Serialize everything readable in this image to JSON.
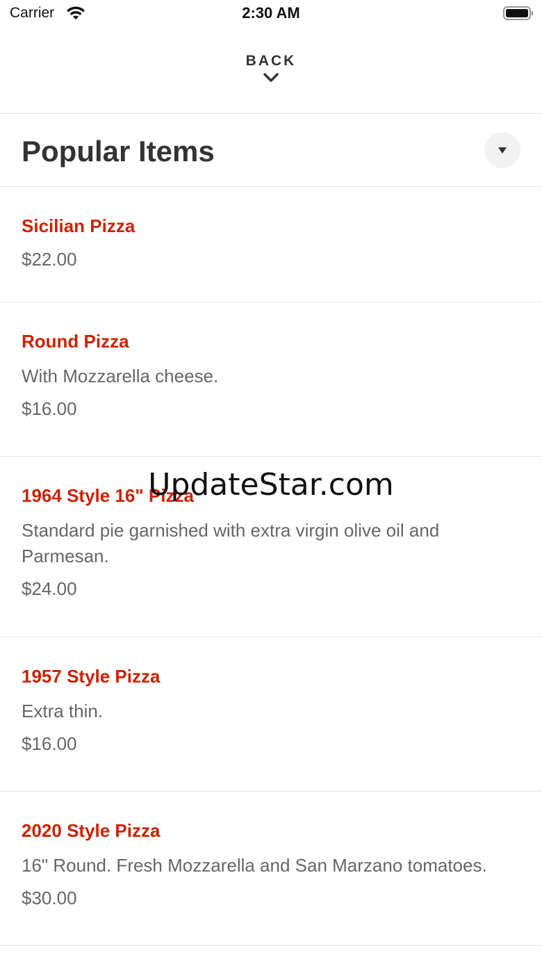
{
  "status_bar": {
    "carrier": "Carrier",
    "time": "2:30 AM"
  },
  "header": {
    "back_label": "BACK"
  },
  "section": {
    "title": "Popular Items"
  },
  "items": [
    {
      "name": "Sicilian Pizza",
      "description": "",
      "price": "$22.00"
    },
    {
      "name": "Round Pizza",
      "description": "With Mozzarella cheese.",
      "price": "$16.00"
    },
    {
      "name": "1964 Style 16\" Pizza",
      "description": "Standard pie garnished with extra virgin olive oil and Parmesan.",
      "price": "$24.00"
    },
    {
      "name": "1957 Style Pizza",
      "description": "Extra thin.",
      "price": "$16.00"
    },
    {
      "name": "2020 Style Pizza",
      "description": "16\" Round. Fresh Mozzarella and San Marzano tomatoes.",
      "price": "$30.00"
    }
  ],
  "watermark": "UpdateStar.com",
  "colors": {
    "accent": "#cc2200",
    "text": "#333333",
    "muted": "#666666",
    "divider": "#e4e4e4"
  },
  "icons": {
    "wifi": "wifi-icon",
    "battery": "battery-icon",
    "back": "chevron-down-icon",
    "dropdown": "triangle-down-icon"
  }
}
